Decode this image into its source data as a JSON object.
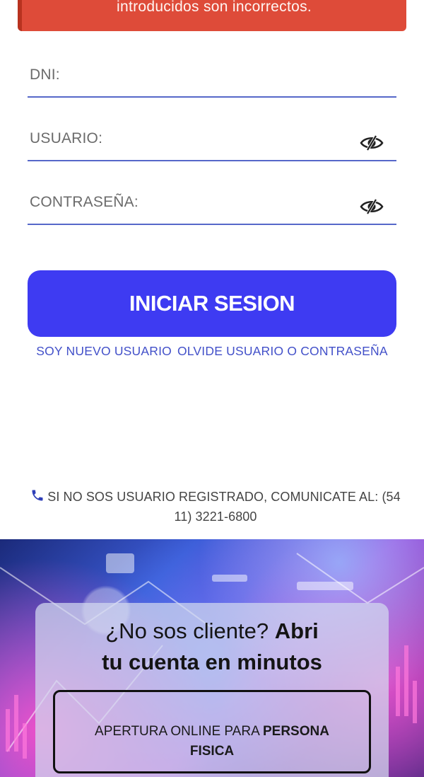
{
  "alert": {
    "message": "introducidos son incorrectos."
  },
  "form": {
    "dni_label": "DNI:",
    "user_label": "USUARIO:",
    "password_label": "CONTRASEÑA:"
  },
  "login_button": "INICIAR SESION",
  "links": {
    "new_user": "SOY NUEVO USUARIO",
    "forgot": "OLVIDE USUARIO O CONTRASEÑA"
  },
  "contact": {
    "icon": "phone-icon",
    "text": "SI NO SOS USUARIO REGISTRADO, COMUNICATE AL: (54 11) 3221-6800"
  },
  "banner": {
    "title_regular": "¿No sos cliente? ",
    "title_bold_1": "Abri",
    "title_bold_2": "tu cuenta en minutos",
    "cta_regular": "APERTURA ONLINE PARA ",
    "cta_bold": "PERSONA FISICA"
  },
  "colors": {
    "alert": "#de4b39",
    "primary": "#3e3bf2",
    "link": "#4250c9",
    "underline": "#5668c9"
  }
}
